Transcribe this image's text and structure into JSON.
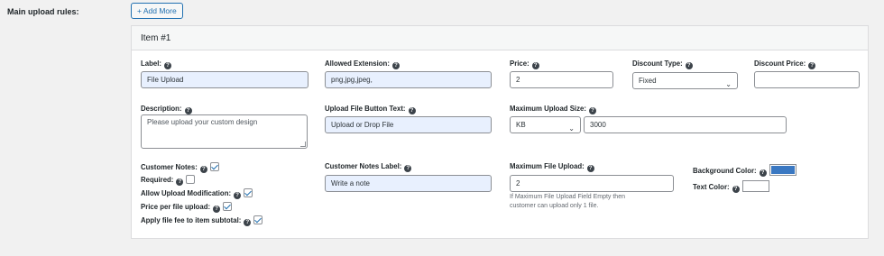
{
  "main_label": "Main upload rules:",
  "add_more_label": "+ Add More",
  "item": {
    "title": "Item #1",
    "label_label": "Label:",
    "label_value": "File Upload",
    "allowed_ext_label": "Allowed Extension:",
    "allowed_ext_value": "png,jpg,jpeg,",
    "price_label": "Price:",
    "price_value": "2",
    "discount_type_label": "Discount Type:",
    "discount_type_value": "Fixed",
    "discount_price_label": "Discount Price:",
    "discount_price_value": "",
    "description_label": "Description:",
    "description_value": "Please upload your custom design",
    "button_text_label": "Upload File Button Text:",
    "button_text_value": "Upload or Drop File",
    "max_size_label": "Maximum Upload Size:",
    "max_size_unit": "KB",
    "max_size_value": "3000",
    "customer_notes_label": "Customer Notes:",
    "customer_notes_checked": true,
    "required_label": "Required:",
    "required_checked": false,
    "allow_mod_label": "Allow Upload Modification:",
    "allow_mod_checked": true,
    "price_per_file_label": "Price per file upload:",
    "price_per_file_checked": true,
    "apply_fee_label": "Apply file fee to item subtotal:",
    "apply_fee_checked": true,
    "notes_label_label": "Customer Notes Label:",
    "notes_label_value": "Write a note",
    "max_file_label": "Maximum File Upload:",
    "max_file_value": "2",
    "max_file_hint_1": "If Maximum File Upload Field Empty then",
    "max_file_hint_2": "customer can upload only 1 file.",
    "bg_color_label": "Background Color:",
    "bg_color_value": "#3a78c2",
    "text_color_label": "Text Color:",
    "text_color_value": "#ffffff"
  },
  "icons": {
    "help": "question-circle-icon",
    "caret": "chevron-down-icon"
  }
}
